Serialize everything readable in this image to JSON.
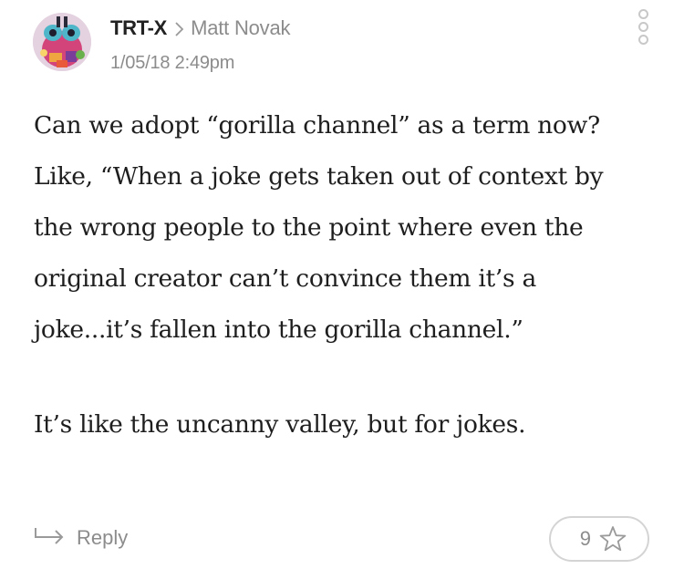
{
  "comment": {
    "author": "TRT-X",
    "reply_to": "Matt Novak",
    "timestamp": "1/05/18 2:49pm",
    "paragraphs": [
      "Can we adopt “gorilla channel” as a term now? Like, “When a joke gets taken out of context by the wrong people to the point where even the original creator can’t convince them it’s a joke...it’s fallen into the gorilla channel.”",
      "It’s like the uncanny valley, but for jokes."
    ]
  },
  "actions": {
    "reply_label": "Reply",
    "star_count": "9"
  },
  "icons": {
    "separator": "chevron-right-icon",
    "menu": "more-vertical-icon",
    "reply": "reply-arrow-icon",
    "star": "star-outline-icon"
  },
  "colors": {
    "text": "#1e1e1e",
    "muted": "#8c8c8c",
    "border": "#d4d4d4"
  }
}
